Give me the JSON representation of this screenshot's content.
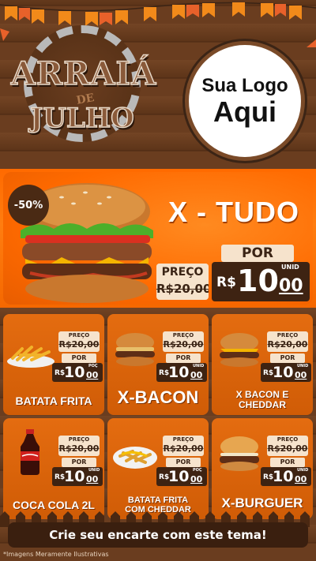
{
  "header": {
    "logo_line1": "ARRAIÁ",
    "logo_line2": "DE",
    "logo_line3": "JULHO",
    "brand_placeholder_line1": "Sua Logo",
    "brand_placeholder_line2": "Aqui"
  },
  "hero": {
    "discount": "-50%",
    "title": "X - TUDO",
    "old_label": "PREÇO",
    "old_price": "R$20,00",
    "por_label": "POR",
    "currency": "R$",
    "price_int": "10",
    "price_cents": "00",
    "unit": "UNID"
  },
  "products": [
    {
      "name": "BATATA FRITA",
      "preco_label": "PREÇO",
      "old_price": "R$20,00",
      "por_label": "POR",
      "currency": "R$",
      "price_int": "10",
      "price_cents": "00",
      "unit": "POÇ",
      "image": "fries"
    },
    {
      "name": "X-BACON",
      "preco_label": "PREÇO",
      "old_price": "R$20,00",
      "por_label": "POR",
      "currency": "R$",
      "price_int": "10",
      "price_cents": "00",
      "unit": "UNID",
      "image": "burger"
    },
    {
      "name": "X BACON E CHEDDAR",
      "preco_label": "PREÇO",
      "old_price": "R$20,00",
      "por_label": "POR",
      "currency": "R$",
      "price_int": "10",
      "price_cents": "00",
      "unit": "UNID",
      "image": "cheese-burger"
    },
    {
      "name": "COCA COLA 2L",
      "preco_label": "PREÇO",
      "old_price": "R$20,00",
      "por_label": "POR",
      "currency": "R$",
      "price_int": "10",
      "price_cents": "00",
      "unit": "UNID",
      "image": "soda-bottle"
    },
    {
      "name": "BATATA FRITA COM CHEDDAR",
      "preco_label": "PREÇO",
      "old_price": "R$20,00",
      "por_label": "POR",
      "currency": "R$",
      "price_int": "10",
      "price_cents": "00",
      "unit": "POÇ",
      "image": "cheddar-fries"
    },
    {
      "name": "X-BURGUER",
      "preco_label": "PREÇO",
      "old_price": "R$20,00",
      "por_label": "POR",
      "currency": "R$",
      "price_int": "10",
      "price_cents": "00",
      "unit": "UNID",
      "image": "plain-burger"
    }
  ],
  "footer": {
    "banner": "Crie seu encarte com este tema!",
    "disclaimer": "*Imagens Meramente Ilustrativas"
  },
  "colors": {
    "accent_orange": "#ff6a00",
    "wood_brown": "#6a3d1f",
    "price_box": "#3e2312",
    "tag_cream": "#f6e3cc"
  }
}
